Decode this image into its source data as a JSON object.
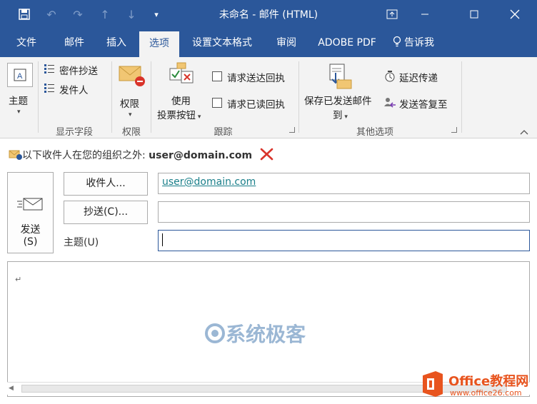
{
  "window": {
    "title": "未命名  -  邮件 (HTML)"
  },
  "tabs": [
    {
      "label": "文件"
    },
    {
      "label": "邮件"
    },
    {
      "label": "插入"
    },
    {
      "label": "选项"
    },
    {
      "label": "设置文本格式"
    },
    {
      "label": "审阅"
    },
    {
      "label": "ADOBE PDF"
    },
    {
      "label": "告诉我"
    }
  ],
  "ribbon": {
    "theme": {
      "label": "主题"
    },
    "show_fields": {
      "bcc": "密件抄送",
      "from": "发件人",
      "group": "显示字段"
    },
    "permission": {
      "label": "权限",
      "group": "权限"
    },
    "tracking": {
      "voting_line1": "使用",
      "voting_line2": "投票按钮",
      "delivery_receipt": "请求送达回执",
      "read_receipt": "请求已读回执",
      "group": "跟踪"
    },
    "more_options": {
      "save_sent_line1": "保存已发送邮件",
      "save_sent_line2": "到",
      "delay_delivery": "延迟传递",
      "direct_replies": "发送答复至",
      "group": "其他选项"
    }
  },
  "infobar": {
    "text": "以下收件人在您的组织之外:",
    "email": "user@domain.com"
  },
  "compose": {
    "send_line1": "发送",
    "send_line2": "(S)",
    "to_button": "收件人...",
    "cc_button": "抄送(C)...",
    "subject_label": "主题(U)",
    "to_value": "user@domain.com",
    "cc_value": "",
    "subject_value": ""
  },
  "body": {
    "paragraph_mark": "↵",
    "watermark": "系统极客"
  },
  "office_badge": {
    "title": "Office教程网",
    "url": "www.office26.com"
  },
  "colors": {
    "accent": "#2b579a",
    "ribbon_bg": "#f3f3f3",
    "link": "#1a7f8a",
    "office_orange": "#e8541e"
  }
}
